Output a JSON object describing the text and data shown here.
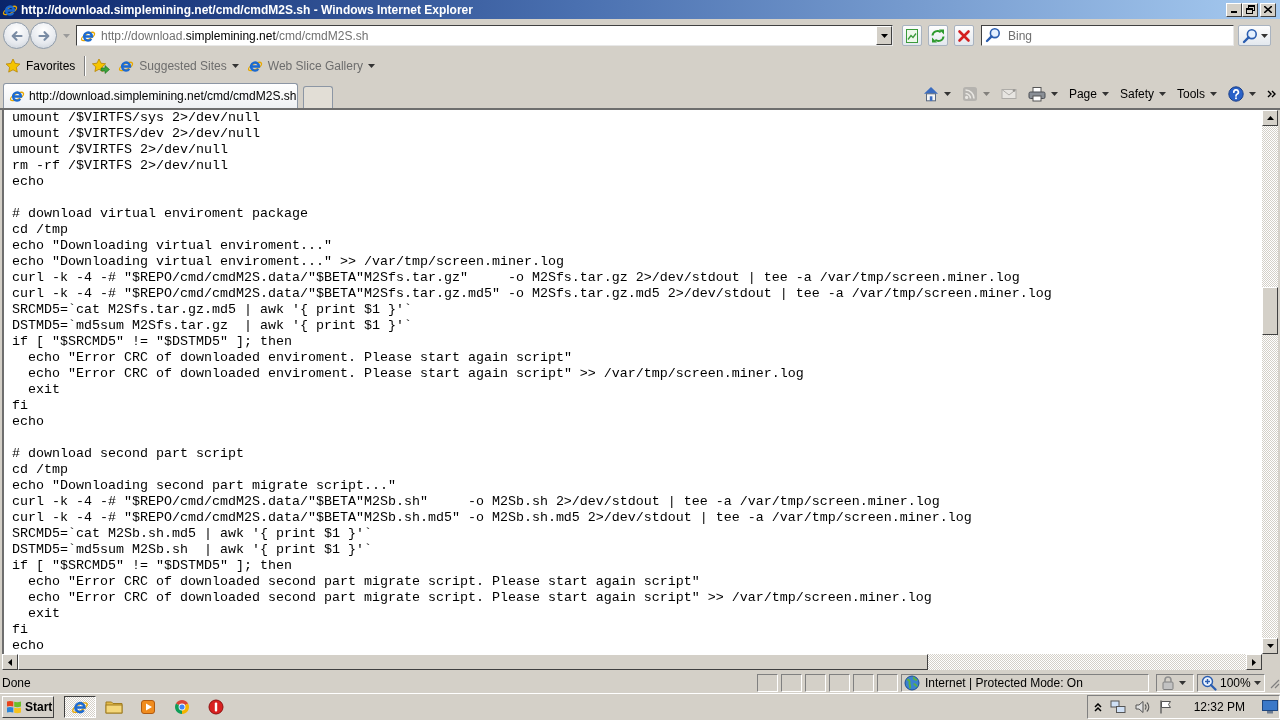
{
  "window": {
    "title": "http://download.simplemining.net/cmd/cmdM2S.sh - Windows Internet Explorer"
  },
  "address_bar": {
    "url": {
      "prefix": "http://download.",
      "domain": "simplemining.net",
      "path": "/cmd/cmdM2S.sh"
    }
  },
  "search": {
    "placeholder": "Bing"
  },
  "favorites_bar": {
    "label": "Favorites",
    "links": [
      {
        "label": "Suggested Sites"
      },
      {
        "label": "Web Slice Gallery"
      }
    ]
  },
  "tabs": [
    {
      "title": "http://download.simplemining.net/cmd/cmdM2S.sh",
      "selected": true
    }
  ],
  "command_bar": {
    "items": [
      {
        "kind": "home",
        "disabled": false,
        "dropdown": true
      },
      {
        "kind": "feeds",
        "disabled": true,
        "dropdown": true
      },
      {
        "kind": "mail",
        "disabled": true,
        "dropdown": false
      },
      {
        "kind": "print",
        "disabled": false,
        "dropdown": true
      },
      {
        "kind": "menu",
        "label": "Page",
        "disabled": false,
        "dropdown": true
      },
      {
        "kind": "menu",
        "label": "Safety",
        "disabled": false,
        "dropdown": true
      },
      {
        "kind": "menu",
        "label": "Tools",
        "disabled": false,
        "dropdown": true
      },
      {
        "kind": "help",
        "disabled": false,
        "dropdown": true
      }
    ]
  },
  "document": {
    "blocks": [
      {
        "lines": [
          {
            "text": "umount /$VIRTFS/sys 2>/dev/null"
          },
          {
            "text": "umount /$VIRTFS/dev 2>/dev/null"
          },
          {
            "text": "umount /$VIRTFS 2>/dev/null"
          },
          {
            "text": "rm -rf /$VIRTFS 2>/dev/null"
          },
          {
            "text": "echo"
          }
        ]
      },
      {
        "lines": [
          {
            "text": "# download virtual enviroment package"
          },
          {
            "text": "cd /tmp"
          },
          {
            "text": "echo \"Downloading virtual enviroment...\""
          },
          {
            "text": "echo \"Downloading virtual enviroment...\" >> /var/tmp/screen.miner.log"
          },
          {
            "text": "curl -k -4 -# \"$REPO/cmd/cmdM2S.data/\"$BETA\"M2Sfs.tar.gz\"     -o M2Sfs.tar.gz 2>/dev/stdout | tee -a /var/tmp/screen.miner.log"
          },
          {
            "text": "curl -k -4 -# \"$REPO/cmd/cmdM2S.data/\"$BETA\"M2Sfs.tar.gz.md5\" -o M2Sfs.tar.gz.md5 2>/dev/stdout | tee -a /var/tmp/screen.miner.log"
          },
          {
            "text": "SRCMD5=`cat M2Sfs.tar.gz.md5 | awk '{ print $1 }'`"
          },
          {
            "text": "DSTMD5=`md5sum M2Sfs.tar.gz  | awk '{ print $1 }'`"
          },
          {
            "text": "if [ \"$SRCMD5\" != \"$DSTMD5\" ]; then",
            "children": [
              {
                "text": "echo \"Error CRC of downloaded enviroment. Please start again script\""
              },
              {
                "text": "echo \"Error CRC of downloaded enviroment. Please start again script\" >> /var/tmp/screen.miner.log"
              },
              {
                "text": "exit"
              }
            ]
          },
          {
            "text": "fi"
          },
          {
            "text": "echo"
          }
        ]
      },
      {
        "lines": [
          {
            "text": "# download second part script"
          },
          {
            "text": "cd /tmp"
          },
          {
            "text": "echo \"Downloading second part migrate script...\""
          },
          {
            "text": "curl -k -4 -# \"$REPO/cmd/cmdM2S.data/\"$BETA\"M2Sb.sh\"     -o M2Sb.sh 2>/dev/stdout | tee -a /var/tmp/screen.miner.log"
          },
          {
            "text": "curl -k -4 -# \"$REPO/cmd/cmdM2S.data/\"$BETA\"M2Sb.sh.md5\" -o M2Sb.sh.md5 2>/dev/stdout | tee -a /var/tmp/screen.miner.log"
          },
          {
            "text": "SRCMD5=`cat M2Sb.sh.md5 | awk '{ print $1 }'`"
          },
          {
            "text": "DSTMD5=`md5sum M2Sb.sh  | awk '{ print $1 }'`"
          },
          {
            "text": "if [ \"$SRCMD5\" != \"$DSTMD5\" ]; then",
            "children": [
              {
                "text": "echo \"Error CRC of downloaded second part migrate script. Please start again script\""
              },
              {
                "text": "echo \"Error CRC of downloaded second part migrate script. Please start again script\" >> /var/tmp/screen.miner.log"
              },
              {
                "text": "exit"
              }
            ]
          },
          {
            "text": "fi"
          },
          {
            "text": "echo"
          }
        ]
      }
    ]
  },
  "status_bar": {
    "text": "Done",
    "zone": "Internet | Protected Mode: On",
    "zoom": "100%"
  },
  "taskbar": {
    "start": "Start",
    "apps": [
      {
        "kind": "browser",
        "selected": true
      },
      {
        "kind": "folder",
        "selected": false
      },
      {
        "kind": "player",
        "selected": false
      },
      {
        "kind": "web",
        "selected": false
      },
      {
        "kind": "alert",
        "selected": false
      }
    ],
    "clock": "12:32 PM"
  }
}
